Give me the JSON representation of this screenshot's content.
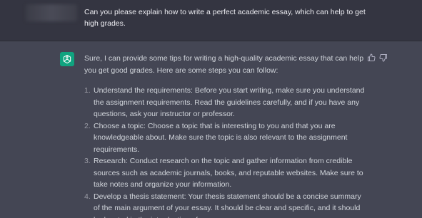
{
  "user_message": {
    "text": "Can you please explain how to write a perfect academic essay, which can help to get high grades."
  },
  "assistant_message": {
    "intro": "Sure, I can provide some tips for writing a high-quality academic essay that can help you get good grades. Here are some steps you can follow:",
    "steps": [
      {
        "num": "1.",
        "text": "Understand the requirements: Before you start writing, make sure you understand the assignment requirements. Read the guidelines carefully, and if you have any questions, ask your instructor or professor."
      },
      {
        "num": "2.",
        "text": "Choose a topic: Choose a topic that is interesting to you and that you are knowledgeable about. Make sure the topic is also relevant to the assignment requirements."
      },
      {
        "num": "3.",
        "text": "Research: Conduct research on the topic and gather information from credible sources such as academic journals, books, and reputable websites. Make sure to take notes and organize your information."
      },
      {
        "num": "4.",
        "text": "Develop a thesis statement: Your thesis statement should be a concise summary of the main argument of your essay. It should be clear and specific, and it should be located in the introduction of your essay."
      }
    ]
  },
  "icons": {
    "assistant_avatar": "openai-logo-icon",
    "thumbs_up": "thumbs-up-icon",
    "thumbs_down": "thumbs-down-icon"
  },
  "colors": {
    "user_bg": "#343541",
    "assistant_bg": "#444654",
    "avatar_green": "#10a37f"
  }
}
